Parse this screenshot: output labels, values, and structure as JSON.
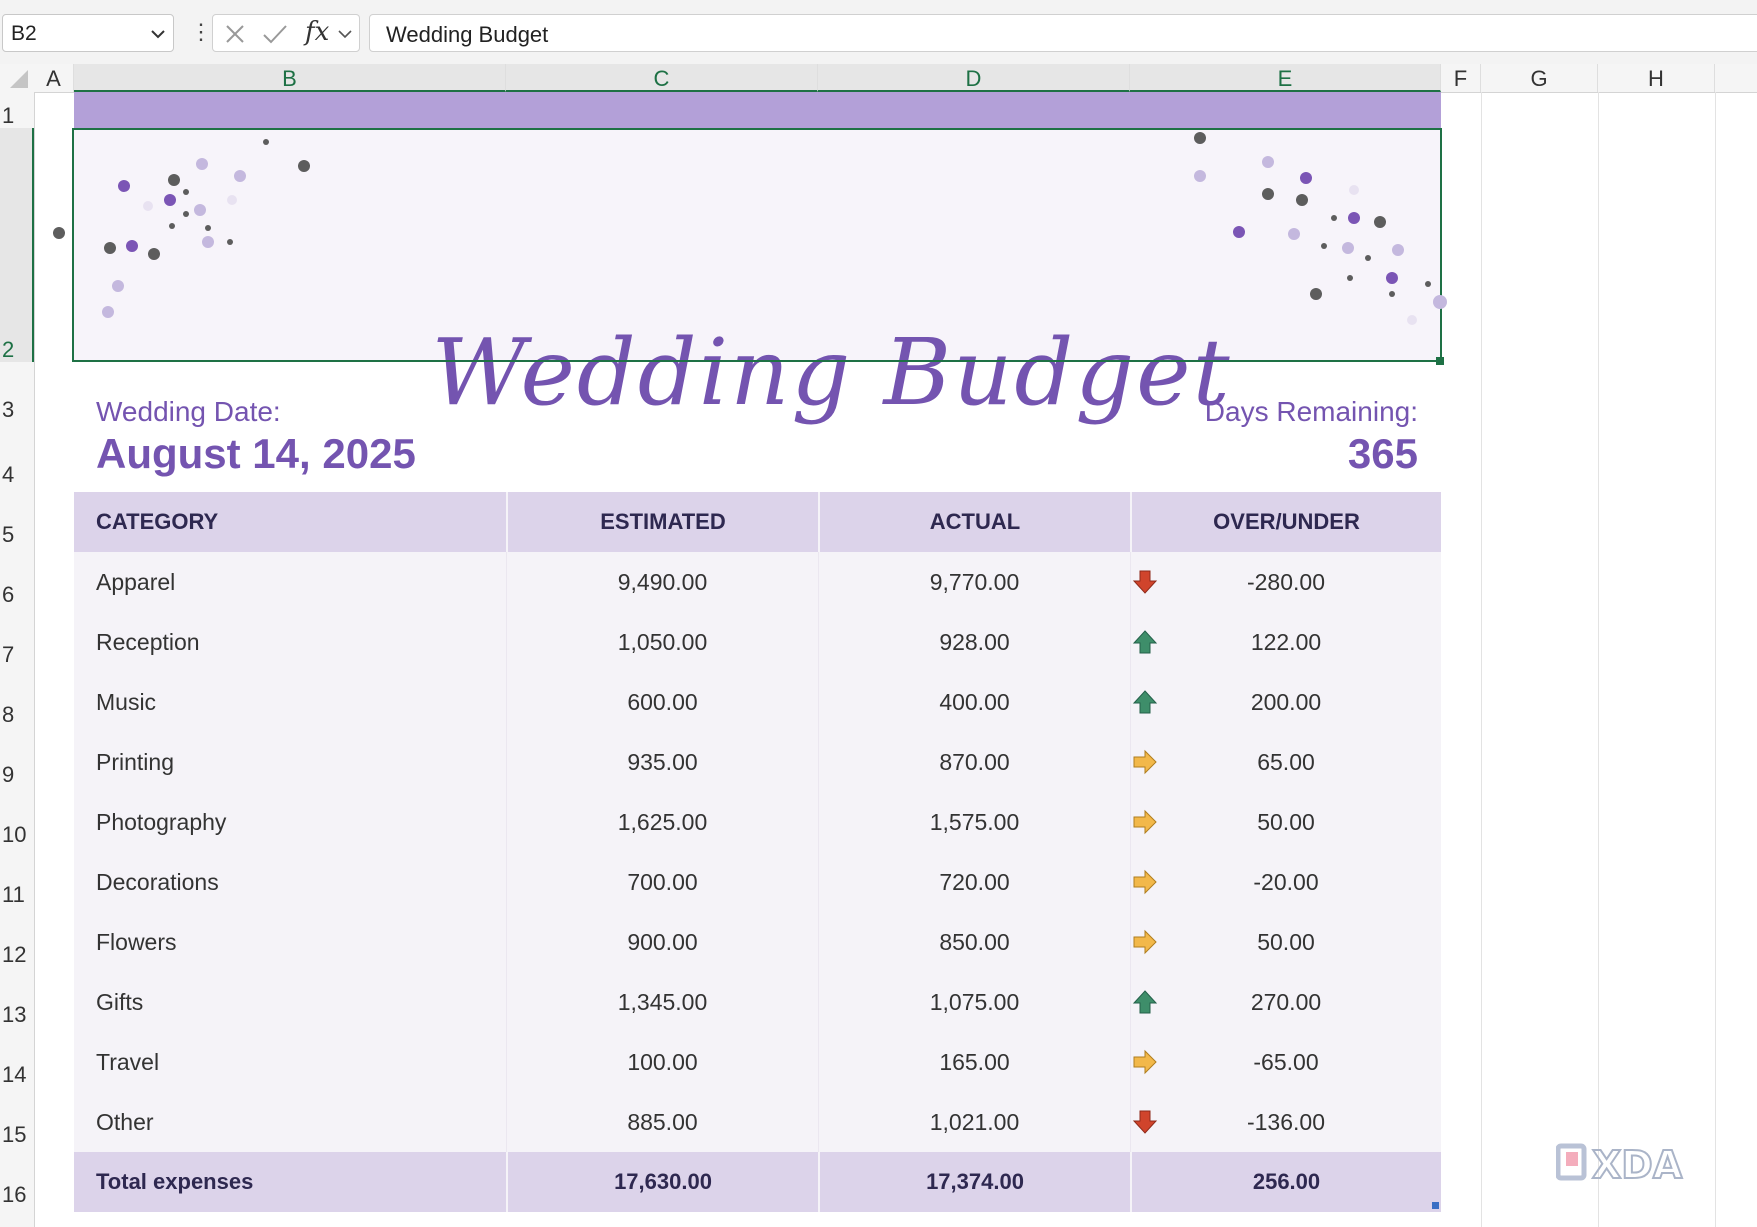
{
  "formula_bar": {
    "name_box": "B2",
    "formula": "Wedding Budget",
    "fx_label": "fx",
    "menu_glyph": "⋮"
  },
  "columns": [
    "A",
    "B",
    "C",
    "D",
    "E",
    "F",
    "G",
    "H"
  ],
  "rows": [
    "1",
    "2",
    "3",
    "4",
    "5",
    "6",
    "7",
    "8",
    "9",
    "10",
    "11",
    "12",
    "13",
    "14",
    "15",
    "16"
  ],
  "banner": {
    "title": "Wedding Budget"
  },
  "wedding": {
    "date_label": "Wedding Date:",
    "date_value": "August 14, 2025",
    "days_label": "Days Remaining:",
    "days_value": "365"
  },
  "table": {
    "headers": {
      "category": "CATEGORY",
      "estimated": "ESTIMATED",
      "actual": "ACTUAL",
      "over_under": "OVER/UNDER"
    },
    "rows": [
      {
        "category": "Apparel",
        "estimated": "9,490.00",
        "actual": "9,770.00",
        "over_under": "-280.00",
        "indicator": "down-arrow-icon"
      },
      {
        "category": "Reception",
        "estimated": "1,050.00",
        "actual": "928.00",
        "over_under": "122.00",
        "indicator": "up-arrow-icon"
      },
      {
        "category": "Music",
        "estimated": "600.00",
        "actual": "400.00",
        "over_under": "200.00",
        "indicator": "up-arrow-icon"
      },
      {
        "category": "Printing",
        "estimated": "935.00",
        "actual": "870.00",
        "over_under": "65.00",
        "indicator": "right-arrow-icon"
      },
      {
        "category": "Photography",
        "estimated": "1,625.00",
        "actual": "1,575.00",
        "over_under": "50.00",
        "indicator": "right-arrow-icon"
      },
      {
        "category": "Decorations",
        "estimated": "700.00",
        "actual": "720.00",
        "over_under": "-20.00",
        "indicator": "right-arrow-icon"
      },
      {
        "category": "Flowers",
        "estimated": "900.00",
        "actual": "850.00",
        "over_under": "50.00",
        "indicator": "right-arrow-icon"
      },
      {
        "category": "Gifts",
        "estimated": "1,345.00",
        "actual": "1,075.00",
        "over_under": "270.00",
        "indicator": "up-arrow-icon"
      },
      {
        "category": "Travel",
        "estimated": "100.00",
        "actual": "165.00",
        "over_under": "-65.00",
        "indicator": "right-arrow-icon"
      },
      {
        "category": "Other",
        "estimated": "885.00",
        "actual": "1,021.00",
        "over_under": "-136.00",
        "indicator": "down-arrow-icon"
      }
    ],
    "total": {
      "category": "Total expenses",
      "estimated": "17,630.00",
      "actual": "17,374.00",
      "over_under": "256.00"
    }
  },
  "colors": {
    "accent_purple": "#7454b0",
    "band_purple": "#b3a0d8",
    "header_fill": "#dcd3ea",
    "selection_green": "#1e7145",
    "arrow_down": "#d0442c",
    "arrow_up": "#3e8e6a",
    "arrow_right": "#f2b84a"
  },
  "watermark": "XDA"
}
